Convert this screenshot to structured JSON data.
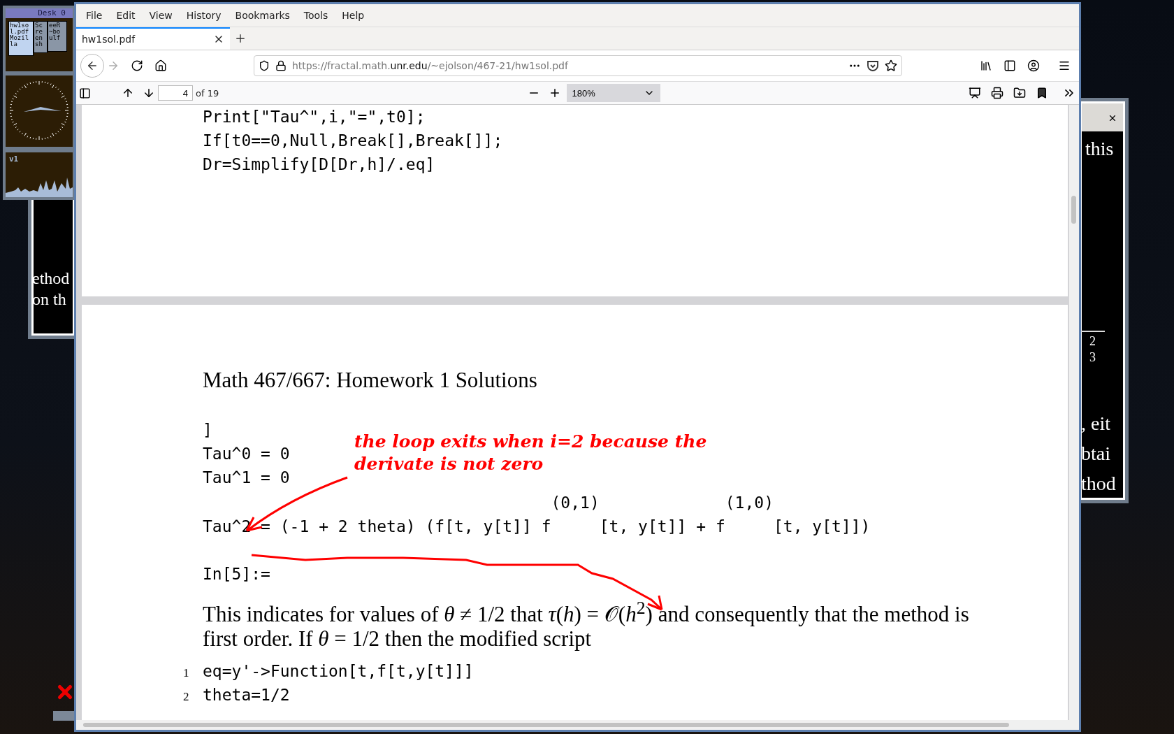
{
  "desktop": {
    "pager": {
      "title": "Desk 0",
      "windows": [
        {
          "lines": [
            "hw1so",
            "l.pdf",
            "Mozil",
            "la"
          ],
          "selected": true
        },
        {
          "lines": [
            "Sc",
            "re",
            "en",
            "sh"
          ],
          "selected": false
        },
        {
          "lines": [
            "eeR",
            "~bo",
            "ulf"
          ],
          "selected": false
        }
      ]
    },
    "monitor": {
      "label": "v1"
    },
    "left_window": {
      "lines": [
        "ethod",
        "on th"
      ]
    },
    "right_window": {
      "top_text": "this",
      "fraction": {
        "numerator": "2",
        "denominator": "3"
      },
      "lines": [
        ", eit",
        "btai",
        "thod"
      ]
    }
  },
  "browser": {
    "menu": [
      "File",
      "Edit",
      "View",
      "History",
      "Bookmarks",
      "Tools",
      "Help"
    ],
    "tabs": [
      {
        "title": "hw1sol.pdf",
        "selected": true
      }
    ],
    "url": {
      "prefix": "https://fractal.math.",
      "domain": "unr.edu",
      "path": "/~ejolson/467-21/hw1sol.pdf"
    },
    "pdf_toolbar": {
      "page": "4",
      "page_count": "of 19",
      "zoom": "180%"
    },
    "document": {
      "page_1_code": [
        "Print[\"Tau^\",i,\"=\",t0];",
        "If[t0==0,Null,Break[],Break[]];",
        "Dr=Simplify[D[Dr,h]/.eq]"
      ],
      "page_2": {
        "header": "Math 467/667: Homework 1 Solutions",
        "output": [
          "]",
          "Tau^0 = 0",
          "Tau^1 = 0",
          "                                    (0,1)             (1,0)",
          "Tau^2 = (-1 + 2 theta) (f[t, y[t]] f     [t, y[t]] + f     [t, y[t]])"
        ],
        "prompt": "In[5]:=",
        "paragraph": "This indicates for values of *θ* ≠ 1/2 that *τ*(*h*) = 𝒪(*h*$^{2}$) and consequently that the method is first order. If *θ* = 1/2 then the modified script",
        "code": [
          {
            "number": "1",
            "text": "eq=y'->Function[t,f[t,y[t]]]"
          },
          {
            "number": "2",
            "text": "theta=1/2"
          }
        ],
        "annotation": "the loop exits when i=2 because the derivate is not zero"
      }
    }
  }
}
